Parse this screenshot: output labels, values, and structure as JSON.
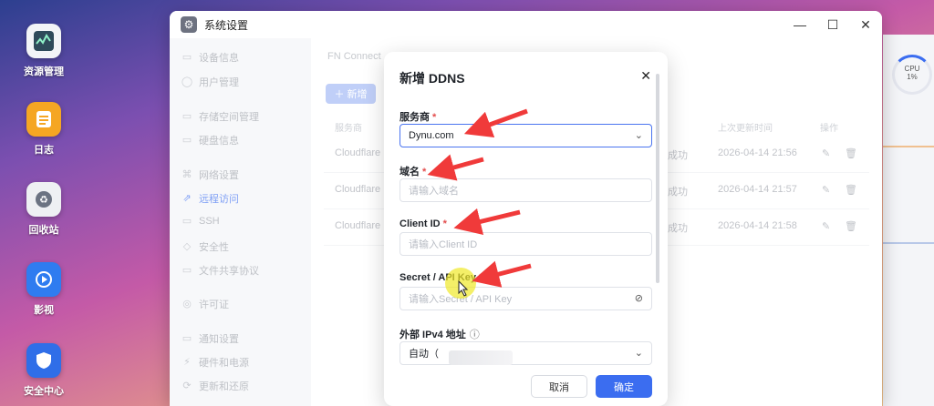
{
  "desktop": {
    "icons": [
      {
        "label": "资源管理",
        "icon": "resource-monitor-icon",
        "color": "#3b5a6e"
      },
      {
        "label": "日志",
        "icon": "log-icon",
        "color": "#f0a530"
      },
      {
        "label": "回收站",
        "icon": "recycle-bin-icon",
        "color": "#8e96a6"
      },
      {
        "label": "影视",
        "icon": "video-icon",
        "color": "#2f7cf0"
      },
      {
        "label": "安全中心",
        "icon": "security-center-icon",
        "color": "#2f6ee8"
      }
    ]
  },
  "widget": {
    "cpu_label": "CPU",
    "cpu_value": "1%"
  },
  "window": {
    "title": "系统设置",
    "icon": "gear-icon",
    "controls": {
      "minimize": "—",
      "maximize": "☐",
      "close": "✕"
    }
  },
  "sidebar": {
    "items": [
      {
        "label": "设备信息",
        "icon": "device-icon"
      },
      {
        "label": "用户管理",
        "icon": "user-icon"
      },
      {
        "label": "存储空间管理",
        "icon": "storage-icon"
      },
      {
        "label": "硬盘信息",
        "icon": "disk-icon"
      },
      {
        "label": "网络设置",
        "icon": "network-icon"
      },
      {
        "label": "远程访问",
        "icon": "remote-icon",
        "active": true
      },
      {
        "label": "SSH",
        "icon": "terminal-icon"
      },
      {
        "label": "安全性",
        "icon": "shield-icon"
      },
      {
        "label": "文件共享协议",
        "icon": "share-icon"
      },
      {
        "label": "许可证",
        "icon": "license-icon"
      },
      {
        "label": "通知设置",
        "icon": "bell-icon"
      },
      {
        "label": "硬件和电源",
        "icon": "power-icon"
      },
      {
        "label": "更新和还原",
        "icon": "update-icon"
      }
    ]
  },
  "content": {
    "breadcrumb": "FN Connect",
    "add_button": "新增",
    "columns": {
      "provider": "服务商",
      "last_update": "上次更新时间",
      "actions": "操作"
    },
    "rows": [
      {
        "provider": "Cloudflare",
        "status": "成功",
        "time": "2026-04-14 21:56"
      },
      {
        "provider": "Cloudflare",
        "status": "成功",
        "time": "2026-04-14 21:57"
      },
      {
        "provider": "Cloudflare",
        "status": "成功",
        "time": "2026-04-14 21:58"
      }
    ]
  },
  "modal": {
    "title": "新增 DDNS",
    "close": "✕",
    "fields": {
      "provider": {
        "label": "服务商",
        "value": "Dynu.com"
      },
      "domain": {
        "label": "域名",
        "placeholder": "请输入域名"
      },
      "client_id": {
        "label": "Client ID",
        "placeholder": "请输入Client ID"
      },
      "secret": {
        "label": "Secret / API Key",
        "placeholder": "请输入Secret / API Key"
      },
      "ipv4": {
        "label": "外部 IPv4 地址",
        "value": "自动（"
      }
    },
    "cancel": "取消",
    "confirm": "确定"
  },
  "colors": {
    "accent": "#3b6df0",
    "required": "#e34d4d",
    "annotation_arrow": "#f03a3a",
    "cursor_highlight": "#f0e828"
  }
}
